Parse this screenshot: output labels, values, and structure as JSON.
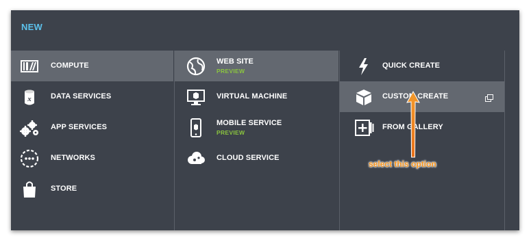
{
  "header": {
    "title": "NEW"
  },
  "categories": [
    {
      "label": "COMPUTE",
      "icon": "compute-icon",
      "selected": true
    },
    {
      "label": "DATA SERVICES",
      "icon": "data-services-icon"
    },
    {
      "label": "APP SERVICES",
      "icon": "gears-icon"
    },
    {
      "label": "NETWORKS",
      "icon": "networks-icon"
    },
    {
      "label": "STORE",
      "icon": "shopping-bag-icon"
    }
  ],
  "services": [
    {
      "label": "WEB SITE",
      "badge": "PREVIEW",
      "icon": "globe-icon",
      "selected": true
    },
    {
      "label": "VIRTUAL MACHINE",
      "icon": "monitor-icon"
    },
    {
      "label": "MOBILE SERVICE",
      "badge": "PREVIEW",
      "icon": "mobile-icon"
    },
    {
      "label": "CLOUD SERVICE",
      "icon": "cloud-gear-icon"
    }
  ],
  "actions": [
    {
      "label": "QUICK CREATE",
      "icon": "lightning-icon"
    },
    {
      "label": "CUSTOM CREATE",
      "icon": "package-icon",
      "selected": true
    },
    {
      "label": "FROM GALLERY",
      "icon": "gallery-add-icon"
    }
  ],
  "annotation": {
    "text": "select this option",
    "color": "#f7941d"
  },
  "colors": {
    "panel": "#3d424b",
    "selected": "#636870",
    "accent": "#5cc2ec",
    "preview": "#8bc53f"
  }
}
